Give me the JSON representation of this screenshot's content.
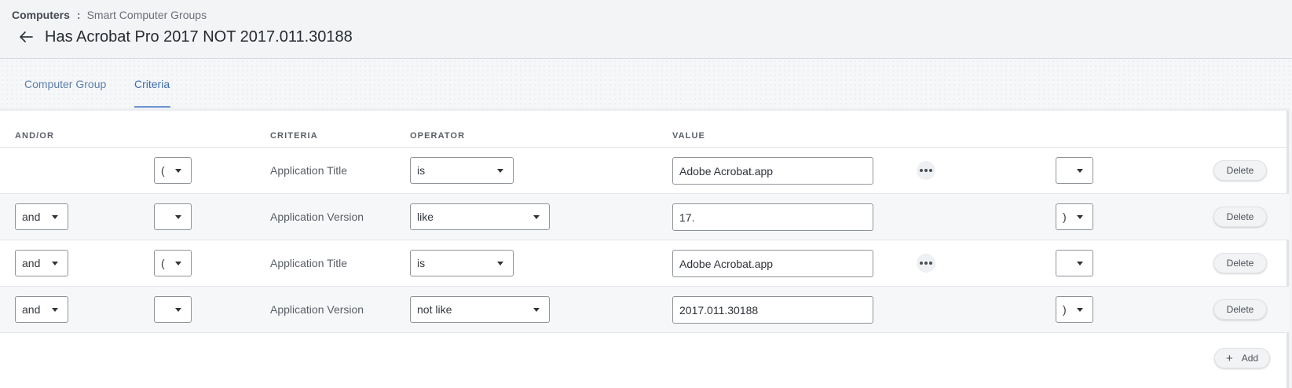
{
  "breadcrumb": {
    "root": "Computers",
    "separator": ":",
    "current": "Smart Computer Groups"
  },
  "page": {
    "title": "Has Acrobat Pro 2017 NOT 2017.011.30188"
  },
  "tabs": [
    {
      "label": "Computer Group",
      "active": false
    },
    {
      "label": "Criteria",
      "active": true
    }
  ],
  "columns": {
    "and_or": "AND/OR",
    "criteria": "CRITERIA",
    "operator": "OPERATOR",
    "value": "VALUE"
  },
  "rows": [
    {
      "and_or": "",
      "open_paren": "(",
      "criteria": "Application Title",
      "operator": "is",
      "value": "Adobe Acrobat.app",
      "has_more": true,
      "close_paren": "",
      "delete_label": "Delete"
    },
    {
      "and_or": "and",
      "open_paren": "",
      "criteria": "Application Version",
      "operator": "like",
      "value": "17.",
      "has_more": false,
      "close_paren": ")",
      "delete_label": "Delete"
    },
    {
      "and_or": "and",
      "open_paren": "(",
      "criteria": "Application Title",
      "operator": "is",
      "value": "Adobe Acrobat.app",
      "has_more": true,
      "close_paren": "",
      "delete_label": "Delete"
    },
    {
      "and_or": "and",
      "open_paren": "",
      "criteria": "Application Version",
      "operator": "not like",
      "value": "2017.011.30188",
      "has_more": false,
      "close_paren": ")",
      "delete_label": "Delete"
    }
  ],
  "add_button": {
    "label": "Add",
    "icon": "plus-icon"
  },
  "icons": {
    "back": "arrow-left-icon",
    "more": "more-horizontal-icon",
    "dropdown": "caret-down-icon"
  },
  "colors": {
    "accent": "#3d6bb0",
    "tab_text": "#5c7fab",
    "header_bg": "#f3f4f6",
    "row_alt_bg": "#f6f7f8"
  }
}
